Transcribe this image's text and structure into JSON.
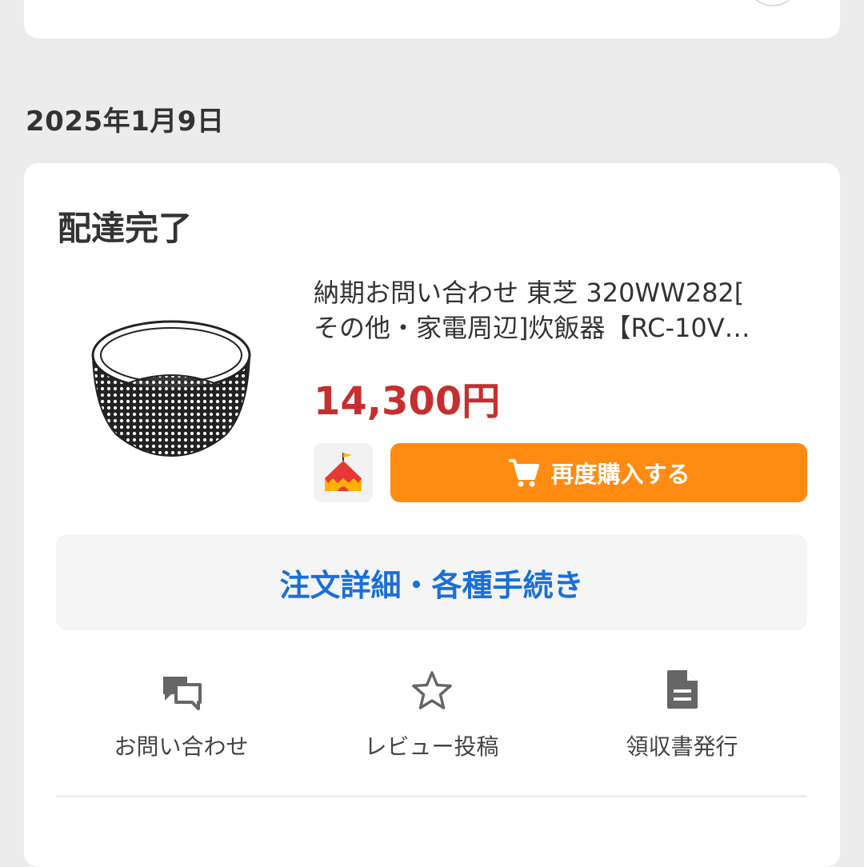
{
  "order_date": "2025年1月9日",
  "card": {
    "status": "配達完了",
    "product": {
      "title": "納期お問い合わせ 東芝 320WW282[\nその他・家電周辺]炊飯器【RC-10V…",
      "price": "14,300円",
      "image_name": "rice-cooker-inner-pot"
    },
    "rebuy_label": "再度購入する",
    "shop_icon": "tent-shop-icon",
    "details_label": "注文詳細・各種手続き",
    "actions": [
      {
        "label": "お問い合わせ",
        "icon": "chat-bubbles-icon"
      },
      {
        "label": "レビュー投稿",
        "icon": "star-icon"
      },
      {
        "label": "領収書発行",
        "icon": "document-icon"
      }
    ]
  },
  "colors": {
    "price": "#c62f2f",
    "rebuy_button": "#ff8b12",
    "details_link": "#1a6fd8",
    "background": "#ececec"
  }
}
